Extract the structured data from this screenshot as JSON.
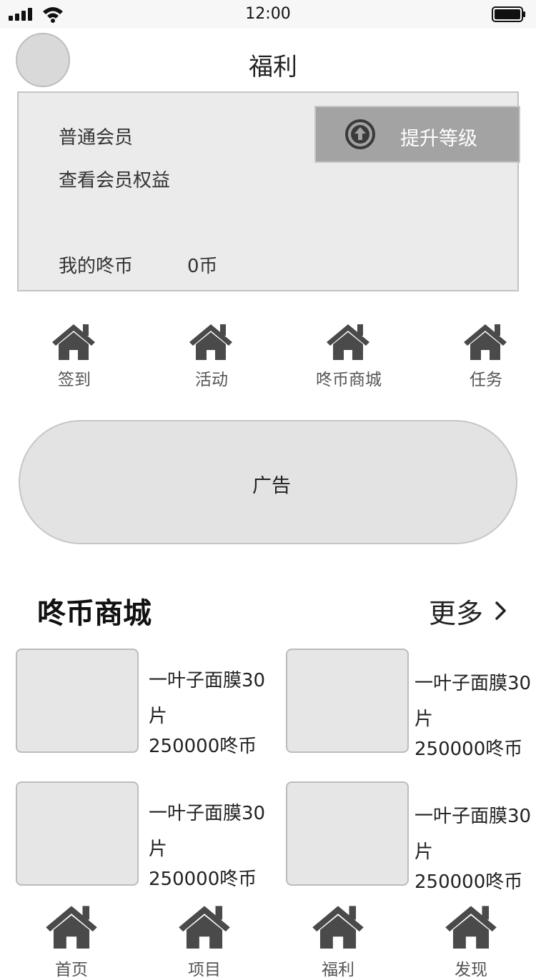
{
  "status_bar": {
    "time": "12:00",
    "signal_icon": "signal-bars-icon",
    "wifi_icon": "wifi-icon",
    "battery_icon": "battery-icon"
  },
  "header": {
    "title": "福利",
    "avatar_icon": "avatar-placeholder"
  },
  "member_card": {
    "level": "普通会员",
    "benefits_link": "查看会员权益",
    "coins_label": "我的咚币",
    "coins_value": "0币",
    "upgrade_label": "提升等级",
    "upgrade_icon": "arrow-up-circle-icon"
  },
  "quick_entries": [
    {
      "label": "签到",
      "icon": "home-icon"
    },
    {
      "label": "活动",
      "icon": "home-icon"
    },
    {
      "label": "咚币商城",
      "icon": "home-icon"
    },
    {
      "label": "任务",
      "icon": "home-icon"
    }
  ],
  "ad_banner": {
    "label": "广告"
  },
  "shop": {
    "title": "咚币商城",
    "more_label": "更多",
    "more_icon": "chevron-right-icon",
    "products": [
      {
        "name": "一叶子面膜30片",
        "price": "250000咚币"
      },
      {
        "name": "一叶子面膜30片",
        "price": "250000咚币"
      },
      {
        "name": "一叶子面膜30片",
        "price": "250000咚币"
      },
      {
        "name": "一叶子面膜30片",
        "price": "250000咚币"
      }
    ]
  },
  "tab_bar": [
    {
      "label": "首页",
      "icon": "home-icon"
    },
    {
      "label": "项目",
      "icon": "home-icon"
    },
    {
      "label": "福利",
      "icon": "home-icon"
    },
    {
      "label": "发现",
      "icon": "home-icon"
    }
  ],
  "colors": {
    "card_bg": "#ebebeb",
    "upgrade_button_bg": "#a3a3a3",
    "icon_dark": "#4a4a4a",
    "banner_bg": "#e3e3e3"
  }
}
